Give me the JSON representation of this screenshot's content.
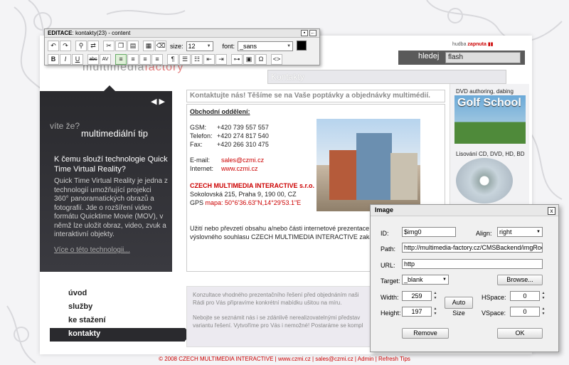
{
  "editor": {
    "title_prefix": "EDITACE",
    "title_rest": ": kontakty(23) - content",
    "size_label": "size:",
    "size_value": "12",
    "font_label": "font:",
    "font_value": "_sans",
    "row1_icons": [
      "undo-icon",
      "redo-icon",
      "find-icon",
      "cut-icon",
      "copy-icon",
      "paste-icon",
      "table-icon",
      "eraser-icon"
    ],
    "row2_buttons": [
      "B",
      "I",
      "U",
      "abc",
      "AV"
    ]
  },
  "header": {
    "brand_small": "hudba",
    "sound_label": "zapnuta",
    "search_label": "hledej",
    "search_value": "flash",
    "logo_part1": "multimedia",
    "logo_part2": "factory",
    "page_tab": "Kontakty"
  },
  "tip": {
    "vite": "víte že?",
    "title": "multimediální tip",
    "question": "K čemu slouží technologie Quick Time Virtual Reality?",
    "body": "Quick Time Virtual Reality je jedna z technologií umožňující projekci 360° panoramatických obrazů a fotografií. Jde o rozšíření video formátu Quicktime Movie (MOV), v němž lze uložit obraz, video, zvuk a interaktivní objekty.",
    "more_link": "Více o této technologii..."
  },
  "content": {
    "heading": "Kontaktujte nás! Těšíme se na Vaše poptávky a objednávky multimédií.",
    "section": "Obchodní oddělení:",
    "contacts": [
      {
        "k": "GSM:",
        "v": "+420 739 557 557"
      },
      {
        "k": "Telefon:",
        "v": "+420 274 817 540"
      },
      {
        "k": "Fax:",
        "v": "+420 266 310 475"
      }
    ],
    "email_label": "E-mail:",
    "email": "sales@czmi.cz",
    "web_label": "Internet:",
    "web": "www.czmi.cz",
    "company": "CZECH MULTIMEDIA INTERACTIVE s.r.o.",
    "address": "Sokolovská 215, Praha 9, 190 00, CZ",
    "gps_label": "GPS",
    "gps": "mapa: 50°6'36.63\"N,14°29'53.1\"E",
    "notice1": "Užití nebo převzetí obsahu a/nebo části internetové prezentace multim",
    "notice2": "výslovného souhlasu CZECH MULTIMEDIA INTERACTIVE zakázáno."
  },
  "right_column": {
    "t1": "DVD authoring, dabing",
    "golf": "Golf School",
    "t2": "Lisování CD, DVD, HD, BD"
  },
  "nav": {
    "items": [
      "úvod",
      "služby",
      "ke stažení",
      "kontakty"
    ],
    "active_index": 3
  },
  "footer_box": {
    "p1": "Konzultace vhodného prezentačního řešení před objednáním naši",
    "p2": "Rádi pro Vás připravíme konkrétní mabídku ušitou na míru.",
    "p3": "Nebojte se seznámit nás i se zdánlivě nerealizovatelnými představ",
    "p4": "variantu řešení. Vytvoříme pro Vás i nemožné! Postaráme se kompl"
  },
  "footer": {
    "text": "© 2008 CZECH MULTIMEDIA INTERACTIVE | www.czmi.cz | sales@czmi.cz | Admin | Refresh Tips"
  },
  "image_dialog": {
    "title": "Image",
    "close": "x",
    "id_label": "ID:",
    "id_value": "$img0",
    "align_label": "Align:",
    "align_value": "right",
    "path_label": "Path:",
    "path_value": "http://multimedia-factory.cz/CMSBackend/imgRoot/kd",
    "url_label": "URL:",
    "url_value": "http",
    "target_label": "Target:",
    "target_value": "_blank",
    "browse": "Browse...",
    "width_label": "Width:",
    "width_value": "259",
    "height_label": "Height:",
    "height_value": "197",
    "auto_size": "Auto Size",
    "hspace_label": "HSpace:",
    "hspace_value": "0",
    "vspace_label": "VSpace:",
    "vspace_value": "0",
    "remove": "Remove",
    "ok": "OK"
  }
}
